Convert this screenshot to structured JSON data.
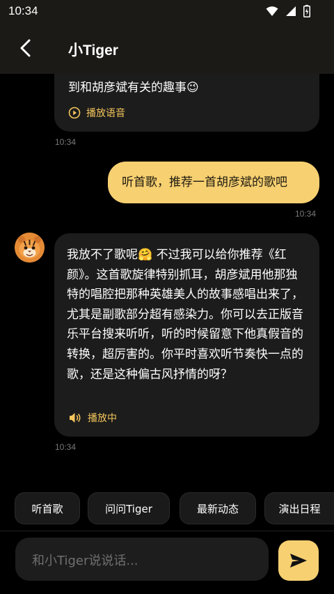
{
  "status_bar": {
    "time": "10:34"
  },
  "header": {
    "title": "小Tiger"
  },
  "messages": [
    {
      "sender": "bot",
      "text": "到和胡彦斌有关的趣事😉",
      "play_label": "播放语音",
      "time": "10:34"
    },
    {
      "sender": "user",
      "text": "听首歌，推荐一首胡彦斌的歌吧",
      "time": "10:34"
    },
    {
      "sender": "bot",
      "text": "我放不了歌呢🤗 不过我可以给你推荐《红颜》。这首歌旋律特别抓耳，胡彦斌用他那独特的唱腔把那种英雄美人的故事感唱出来了，尤其是副歌部分超有感染力。你可以去正版音乐平台搜来听听，听的时候留意下他真假音的转换，超厉害的。你平时喜欢听节奏快一点的歌，还是这种偏古风抒情的呀？",
      "play_label": "播放中",
      "time": "10:34"
    }
  ],
  "quick_replies": [
    "听首歌",
    "问问Tiger",
    "最新动态",
    "演出日程"
  ],
  "composer": {
    "placeholder": "和小Tiger说说话..."
  },
  "colors": {
    "accent": "#f7d071",
    "bubble_bot": "#1c1c1c",
    "background": "#000000",
    "header": "#1c1a17"
  },
  "icons": {
    "back": "chevron-left-icon",
    "play": "play-circle-icon",
    "playing": "speaker-icon",
    "send": "send-icon",
    "avatar": "tiger-avatar"
  }
}
